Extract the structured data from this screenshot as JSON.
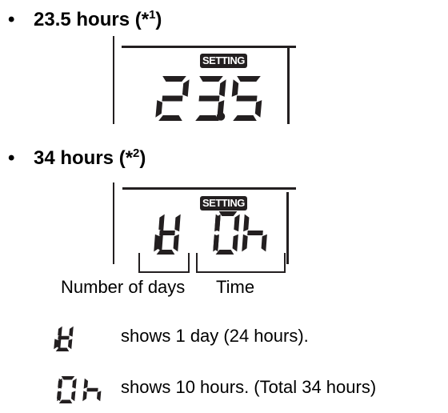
{
  "sections": [
    {
      "heading": "23.5 hours",
      "note_prefix": "(*",
      "note_number": "1",
      "note_suffix": ")",
      "display": {
        "badge": "SETTING",
        "value": "23.5"
      }
    },
    {
      "heading": "34 hours",
      "note_prefix": "(*",
      "note_number": "2",
      "note_suffix": ")",
      "display": {
        "badge": "SETTING",
        "value": "1d 10h"
      }
    }
  ],
  "bullet": "•",
  "labels": {
    "days": "Number of days",
    "time": "Time"
  },
  "legend": [
    {
      "symbol": "1d",
      "text": "shows 1 day (24 hours)."
    },
    {
      "symbol": "10h",
      "text": "shows 10 hours. (Total 34 hours)"
    }
  ]
}
